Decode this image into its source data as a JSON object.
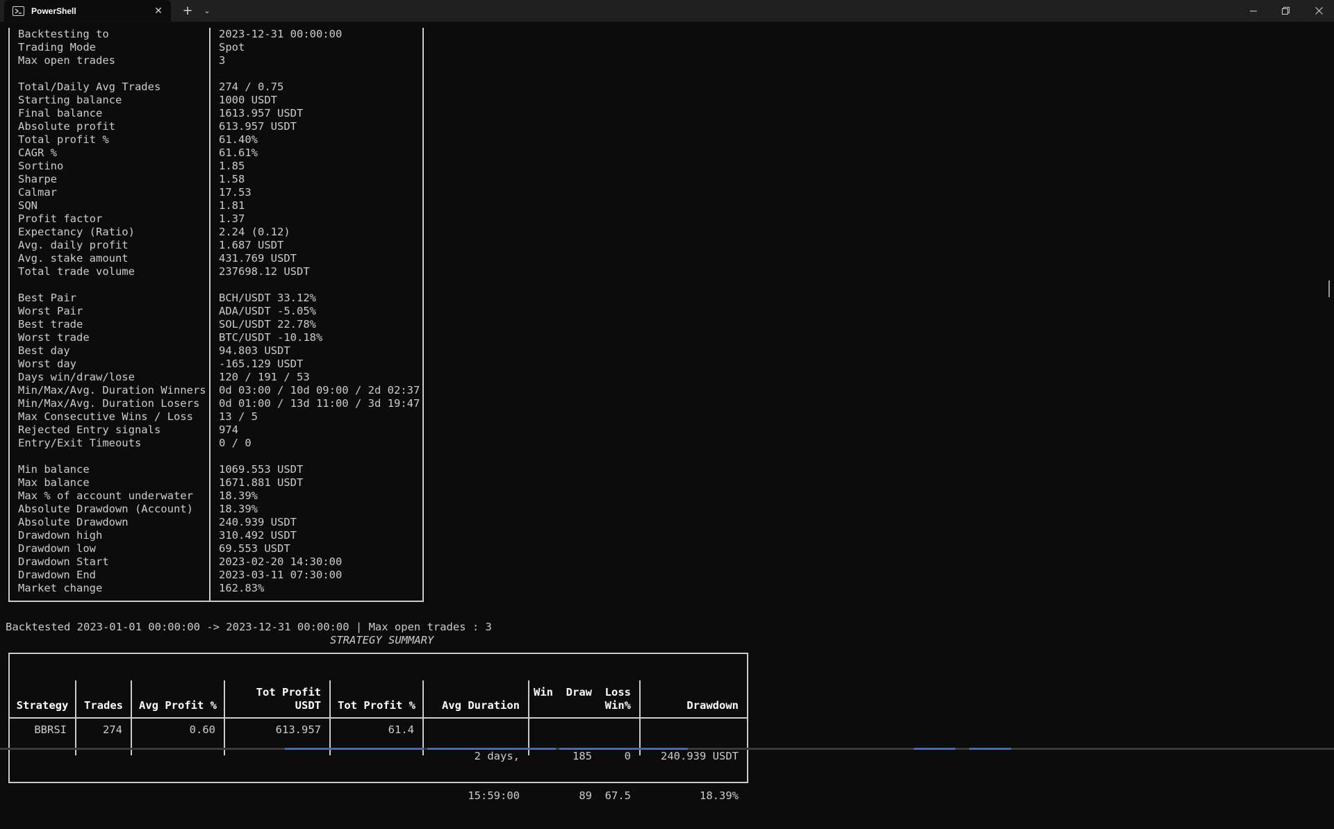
{
  "window": {
    "tab_title": "PowerShell",
    "tab_icon": "powershell-icon",
    "new_tab": "+",
    "dropdown": "⌄",
    "close_tab": "✕",
    "minimize": "—",
    "maximize": "❐",
    "close": "✕"
  },
  "stats": [
    {
      "label": "Backtesting to",
      "value": "2023-12-31 00:00:00"
    },
    {
      "label": "Trading Mode",
      "value": "Spot"
    },
    {
      "label": "Max open trades",
      "value": "3"
    },
    {
      "label": "Total/Daily Avg Trades",
      "value": "274 / 0.75"
    },
    {
      "label": "Starting balance",
      "value": "1000 USDT"
    },
    {
      "label": "Final balance",
      "value": "1613.957 USDT"
    },
    {
      "label": "Absolute profit",
      "value": "613.957 USDT"
    },
    {
      "label": "Total profit %",
      "value": "61.40%"
    },
    {
      "label": "CAGR %",
      "value": "61.61%"
    },
    {
      "label": "Sortino",
      "value": "1.85"
    },
    {
      "label": "Sharpe",
      "value": "1.58"
    },
    {
      "label": "Calmar",
      "value": "17.53"
    },
    {
      "label": "SQN",
      "value": "1.81"
    },
    {
      "label": "Profit factor",
      "value": "1.37"
    },
    {
      "label": "Expectancy (Ratio)",
      "value": "2.24 (0.12)"
    },
    {
      "label": "Avg. daily profit",
      "value": "1.687 USDT"
    },
    {
      "label": "Avg. stake amount",
      "value": "431.769 USDT"
    },
    {
      "label": "Total trade volume",
      "value": "237698.12 USDT"
    },
    {
      "label": "Best Pair",
      "value": "BCH/USDT 33.12%"
    },
    {
      "label": "Worst Pair",
      "value": "ADA/USDT -5.05%"
    },
    {
      "label": "Best trade",
      "value": "SOL/USDT 22.78%"
    },
    {
      "label": "Worst trade",
      "value": "BTC/USDT -10.18%"
    },
    {
      "label": "Best day",
      "value": "94.803 USDT"
    },
    {
      "label": "Worst day",
      "value": "-165.129 USDT"
    },
    {
      "label": "Days win/draw/lose",
      "value": "120 / 191 / 53"
    },
    {
      "label": "Min/Max/Avg. Duration Winners",
      "value": "0d 03:00 / 10d 09:00 / 2d 02:37"
    },
    {
      "label": "Min/Max/Avg. Duration Losers",
      "value": "0d 01:00 / 13d 11:00 / 3d 19:47"
    },
    {
      "label": "Max Consecutive Wins / Loss",
      "value": "13 / 5"
    },
    {
      "label": "Rejected Entry signals",
      "value": "974"
    },
    {
      "label": "Entry/Exit Timeouts",
      "value": "0 / 0"
    },
    {
      "label": "Min balance",
      "value": "1069.553 USDT"
    },
    {
      "label": "Max balance",
      "value": "1671.881 USDT"
    },
    {
      "label": "Max % of account underwater",
      "value": "18.39%"
    },
    {
      "label": "Absolute Drawdown (Account)",
      "value": "18.39%"
    },
    {
      "label": "Absolute Drawdown",
      "value": "240.939 USDT"
    },
    {
      "label": "Drawdown high",
      "value": "310.492 USDT"
    },
    {
      "label": "Drawdown low",
      "value": "69.553 USDT"
    },
    {
      "label": "Drawdown Start",
      "value": "2023-02-20 14:30:00"
    },
    {
      "label": "Drawdown End",
      "value": "2023-03-11 07:30:00"
    },
    {
      "label": "Market change",
      "value": "162.83%"
    }
  ],
  "summary_line": "Backtested 2023-01-01 00:00:00 -> 2023-12-31 00:00:00 | Max open trades : 3",
  "strategy_summary_title": "STRATEGY SUMMARY",
  "summary_table": {
    "headers": {
      "strategy": "Strategy",
      "trades": "Trades",
      "avg_profit": "Avg Profit %",
      "tot_profit_l1": "Tot Profit",
      "tot_profit_l2": "USDT",
      "tot_profit_pct": "Tot Profit %",
      "avg_duration": "Avg Duration",
      "wdl_l1": "Win  Draw  Loss",
      "wdl_l2": "Win%",
      "drawdown": "Drawdown"
    },
    "row": {
      "strategy": "BBRSI",
      "trades": "274",
      "avg_profit": "0.60",
      "tot_profit": "613.957",
      "tot_profit_pct": "61.4",
      "avg_duration_l1": "2 days,",
      "avg_duration_l2": "15:59:00",
      "wdl_l1": "185     0",
      "wdl_l2": "89  67.5",
      "drawdown_l1": "240.939 USDT",
      "drawdown_l2": "18.39%"
    }
  }
}
